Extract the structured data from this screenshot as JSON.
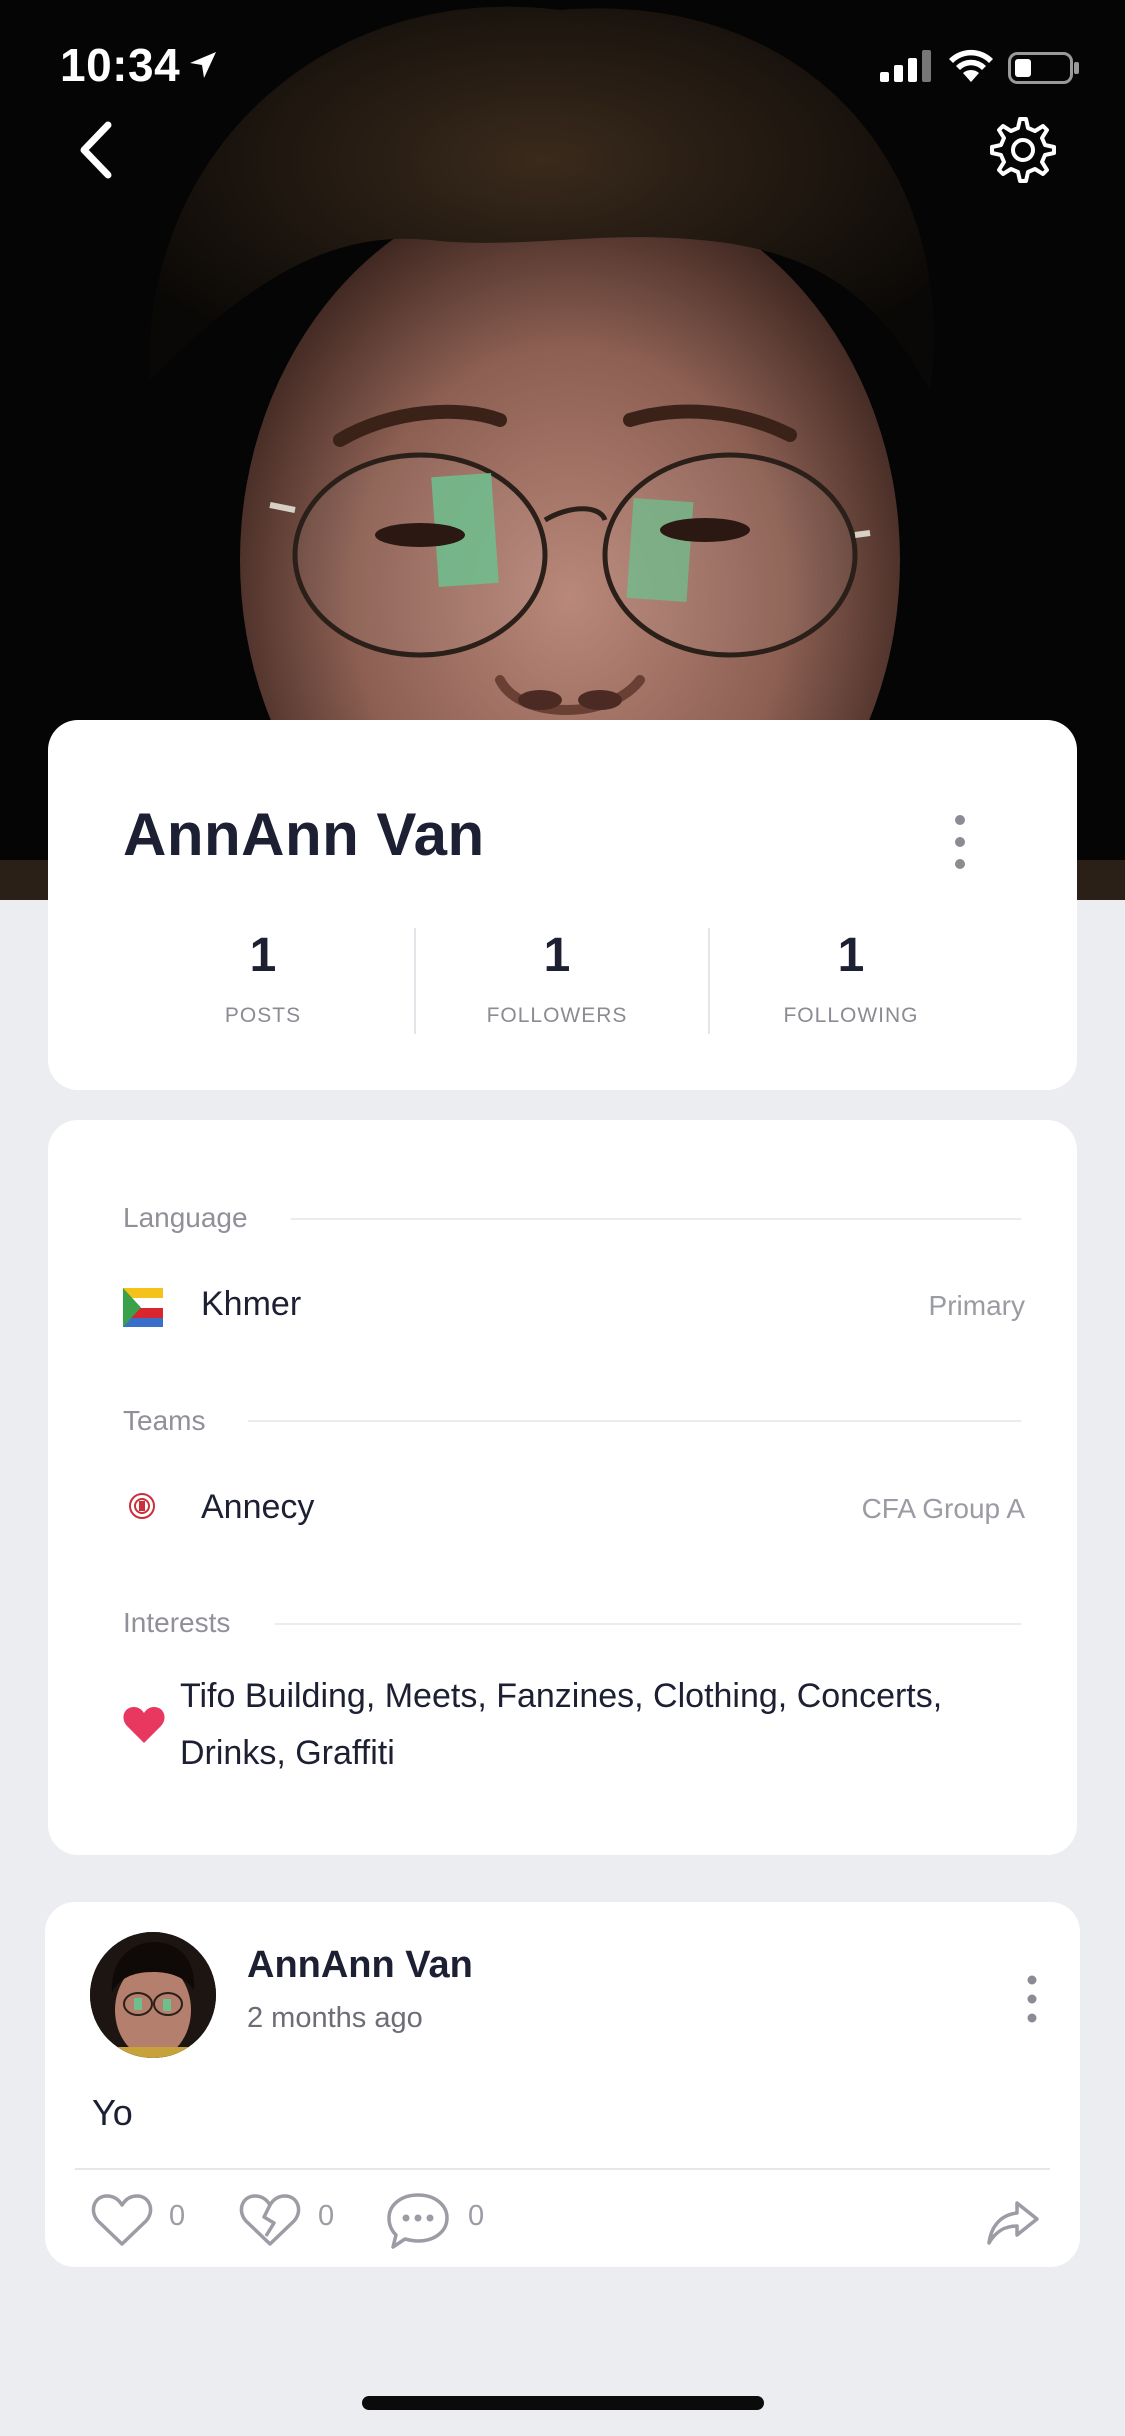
{
  "status_bar": {
    "time": "10:34",
    "icons": [
      "location-arrow-icon",
      "cellular-signal-icon",
      "wifi-icon",
      "battery-icon"
    ]
  },
  "header": {
    "back_icon": "chevron-left-icon",
    "settings_icon": "gear-icon"
  },
  "profile": {
    "name": "AnnAnn Van",
    "stats": [
      {
        "value": "1",
        "label": "POSTS"
      },
      {
        "value": "1",
        "label": "FOLLOWERS"
      },
      {
        "value": "1",
        "label": "FOLLOWING"
      }
    ]
  },
  "details": {
    "language": {
      "title": "Language",
      "name": "Khmer",
      "tag": "Primary"
    },
    "teams": {
      "title": "Teams",
      "name": "Annecy",
      "tag": "CFA Group A"
    },
    "interests": {
      "title": "Interests",
      "text": "Tifo Building, Meets, Fanzines, Clothing, Concerts, Drinks, Graffiti"
    }
  },
  "post": {
    "author": "AnnAnn Van",
    "time": "2 months ago",
    "text": "Yo",
    "likes": "0",
    "dislikes": "0",
    "comments": "0"
  },
  "colors": {
    "accent_heart": "#e8385f",
    "text_dark": "#1d1f33",
    "background": "#ecedf1"
  }
}
